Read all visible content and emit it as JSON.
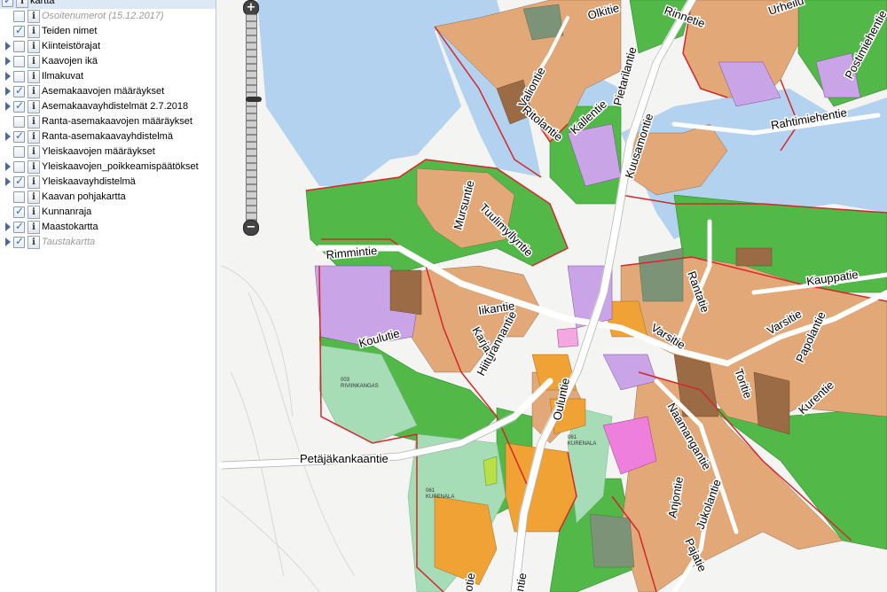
{
  "layers": [
    {
      "label": "kartta",
      "checked": true,
      "root": true
    },
    {
      "label": "Osoitenumerot (15.12.2017)",
      "checked": false,
      "dim": true,
      "toggle": false
    },
    {
      "label": "Teiden nimet",
      "checked": true,
      "toggle": false
    },
    {
      "label": "Kiinteistörajat",
      "checked": false,
      "toggle": true
    },
    {
      "label": "Kaavojen ikä",
      "checked": false,
      "toggle": true
    },
    {
      "label": "Ilmakuvat",
      "checked": false,
      "toggle": true
    },
    {
      "label": "Asemakaavojen määräykset",
      "checked": true,
      "toggle": true
    },
    {
      "label": "Asemakaavayhdistelmät 2.7.2018",
      "checked": true,
      "toggle": true
    },
    {
      "label": "Ranta-asemakaavojen määräykset",
      "checked": false,
      "toggle": false
    },
    {
      "label": "Ranta-asemakaavayhdistelmä",
      "checked": true,
      "toggle": true
    },
    {
      "label": "Yleiskaavojen määräykset",
      "checked": false,
      "toggle": false
    },
    {
      "label": "Yleiskaavojen_poikkeamispäätökset",
      "checked": false,
      "toggle": true
    },
    {
      "label": "Yleiskaavayhdistelmä",
      "checked": true,
      "toggle": true
    },
    {
      "label": "Kaavan pohjakartta",
      "checked": false,
      "toggle": false
    },
    {
      "label": "Kunnanraja",
      "checked": true,
      "toggle": false
    },
    {
      "label": "Maastokartta",
      "checked": true,
      "toggle": true
    },
    {
      "label": "Taustakartta",
      "checked": true,
      "dim": true,
      "toggle": true
    }
  ],
  "zoom": {
    "plus": "+",
    "minus": "−"
  },
  "streets": {
    "olkitie": "Olkitie",
    "pietarilantie": "Pietarilantie",
    "valiontie": "Valiontie",
    "ritolantie": "Ritolantie",
    "kallentie": "Kallentie",
    "kuusamontie": "Kuusamontie",
    "rahtimiehentie": "Rahtimiehentie",
    "postimiehentie": "Postimiehentie",
    "urheilu": "Urheilu",
    "mursuntie": "Mursuntie",
    "tuulimyllyntie": "Tuulimyllyntie",
    "rimmintie": "Rimmintie",
    "iikantie": "Iikantie",
    "koulutie": "Koulutie",
    "karjatie": "Karjatie",
    "hiiturannantie": "Hiiturannantie",
    "rantatie": "Rantatie",
    "kauppatie": "Kauppatie",
    "varsitie": "Varsitie",
    "varsitie2": "Varsitie",
    "papolantie": "Papolantie",
    "toritie": "Toritie",
    "kurentie": "Kurentie",
    "naamangantie": "Naamangantie",
    "ouluntie": "Ouluntie",
    "petajakankaantie": "Petäjäkankaantie",
    "jukolantie": "Jukolantie",
    "anjontie": "Anjontie",
    "pajatie": "Pajatie",
    "rinnetie": "Rinnetie",
    "otie": "otie",
    "ntie": "ntie"
  },
  "area_labels": {
    "rivinkangas": "003\nRIVIINKANGAS",
    "kurenala1": "061\nKURENALA",
    "kurenala2": "061\nKURENALA"
  }
}
